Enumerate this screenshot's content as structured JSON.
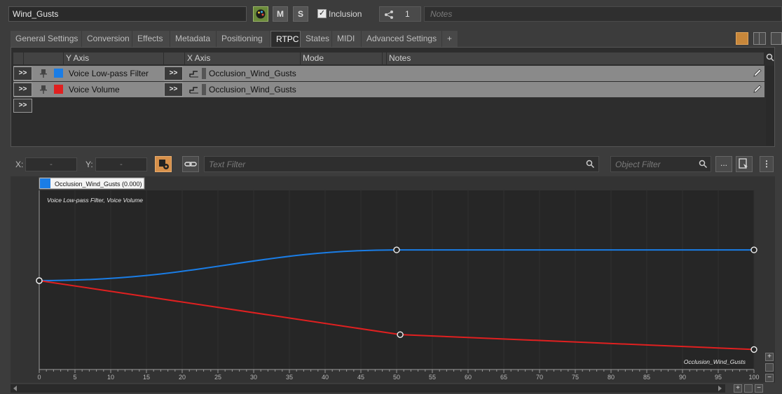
{
  "header": {
    "object_name": "Wind_Gusts",
    "m_label": "M",
    "s_label": "S",
    "inclusion_label": "Inclusion",
    "inclusion_checked": true,
    "share_count": "1",
    "notes_placeholder": "Notes"
  },
  "tabs": [
    {
      "label": "General Settings",
      "active": false
    },
    {
      "label": "Conversion",
      "active": false
    },
    {
      "label": "Effects",
      "active": false
    },
    {
      "label": "Metadata",
      "active": false
    },
    {
      "label": "Positioning",
      "active": false
    },
    {
      "label": "RTPC",
      "active": true
    },
    {
      "label": "States",
      "active": false
    },
    {
      "label": "MIDI",
      "active": false
    },
    {
      "label": "Advanced Settings",
      "active": false
    },
    {
      "label": "+",
      "active": false
    }
  ],
  "rtpc_table": {
    "columns": {
      "y_axis": "Y Axis",
      "x_axis": "X Axis",
      "mode": "Mode",
      "notes": "Notes"
    },
    "expand_label": ">>",
    "rows": [
      {
        "y_axis": "Voice Low-pass Filter",
        "color": "#1a7de6",
        "x_axis": "Occlusion_Wind_Gusts"
      },
      {
        "y_axis": "Voice Volume",
        "color": "#e02020",
        "x_axis": "Occlusion_Wind_Gusts"
      }
    ]
  },
  "graph_toolbar": {
    "x_label": "X:",
    "y_label": "Y:",
    "x_value": "-",
    "y_value": "-",
    "text_filter_placeholder": "Text Filter",
    "object_filter_placeholder": "Object Filter",
    "more_label": "..."
  },
  "chart_data": {
    "type": "line",
    "legend_label": "Occlusion_Wind_Gusts (0.000)",
    "curve_names_label": "Voice Low-pass Filter, Voice Volume",
    "x_axis_name": "Occlusion_Wind_Gusts",
    "xlim": [
      0,
      100
    ],
    "x_ticks": [
      0,
      5,
      10,
      15,
      20,
      25,
      30,
      35,
      40,
      45,
      50,
      55,
      60,
      65,
      70,
      75,
      80,
      85,
      90,
      95,
      100
    ],
    "series": [
      {
        "color": "#1a7de6",
        "points": [
          [
            0,
            0
          ],
          [
            50,
            0.33
          ],
          [
            100,
            0.33
          ]
        ],
        "curve": "scurve_first"
      },
      {
        "color": "#e02020",
        "points": [
          [
            0,
            0
          ],
          [
            50.5,
            -0.58
          ],
          [
            100,
            -0.74
          ]
        ],
        "curve": "linear"
      }
    ]
  }
}
